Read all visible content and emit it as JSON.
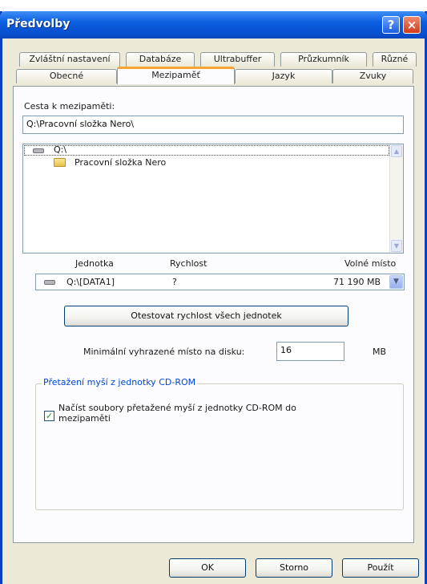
{
  "window": {
    "title": "Předvolby"
  },
  "tabs_row1": [
    "Zvláštní nastavení",
    "Databáze",
    "Ultrabuffer",
    "Průzkumník",
    "Různé"
  ],
  "tabs_row2": [
    "Obecné",
    "Mezipaměť",
    "Jazyk",
    "Zvuky"
  ],
  "active_tab": "Mezipaměť",
  "cache_path": {
    "label": "Cesta k mezipaměti:",
    "value": "Q:\\Pracovní složka Nero\\"
  },
  "folder_tree": [
    {
      "name": "Q:\\",
      "icon": "drive-icon"
    },
    {
      "name": "Pracovní složka Nero",
      "icon": "folder-icon"
    }
  ],
  "drive_table": {
    "headers": [
      "Jednotka",
      "Rychlost",
      "Volné místo"
    ],
    "selected": {
      "drive": "Q:\\[DATA1]",
      "speed": "?",
      "free": "71 190 MB"
    }
  },
  "buttons": {
    "test_speed": "Otestovat rychlost všech jednotek",
    "ok": "OK",
    "cancel": "Storno",
    "apply": "Použít"
  },
  "min_space": {
    "label": "Minimální vyhrazené místo na disku:",
    "value": "16",
    "unit": "MB"
  },
  "cdrom_group": {
    "title": "Přetažení myší z jednotky CD-ROM",
    "checkbox_label": "Načíst soubory přetažené myší z jednotky CD-ROM do mezipaměti",
    "checked": true
  }
}
